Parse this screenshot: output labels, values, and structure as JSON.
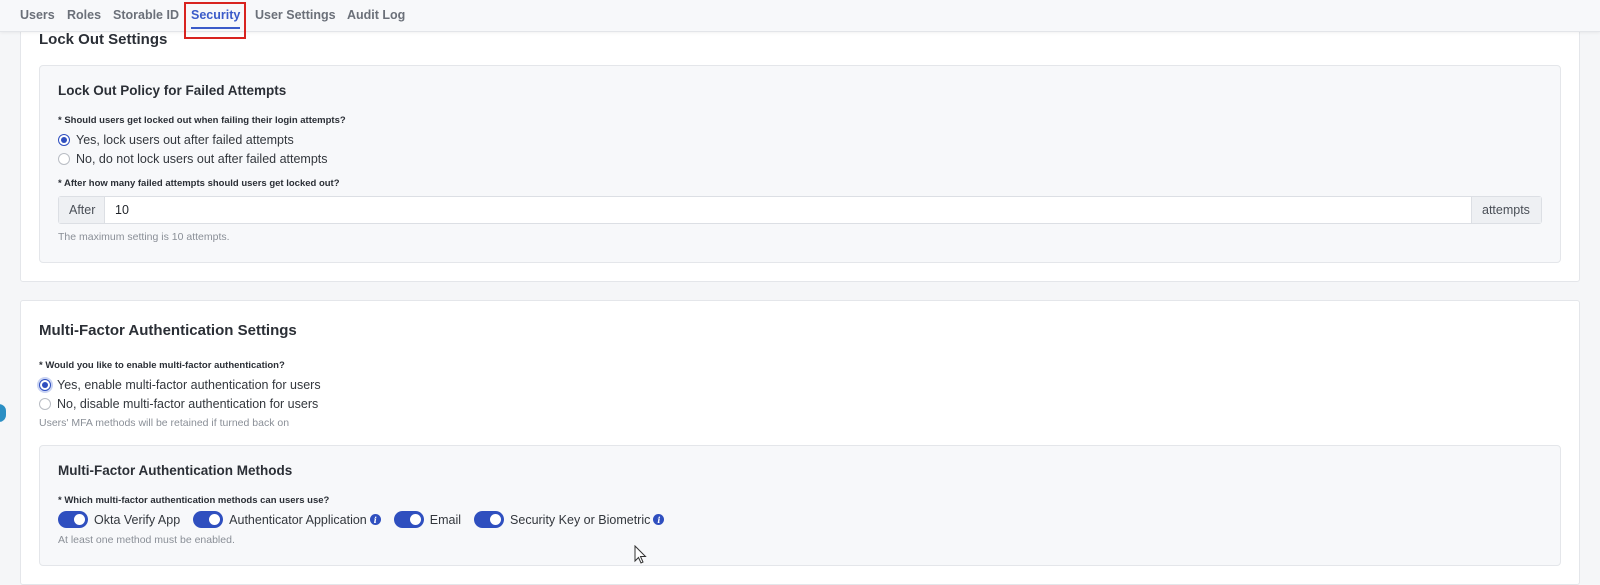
{
  "tabs": [
    {
      "label": "Users"
    },
    {
      "label": "Roles"
    },
    {
      "label": "Storable ID"
    },
    {
      "label": "Security",
      "active": true
    },
    {
      "label": "User Settings"
    },
    {
      "label": "Audit Log"
    }
  ],
  "lockout": {
    "title": "Lock Out Settings",
    "policy_title": "Lock Out Policy for Failed Attempts",
    "question1": "* Should users get locked out when failing their login attempts?",
    "option_yes": "Yes, lock users out after failed attempts",
    "option_no": "No, do not lock users out after failed attempts",
    "selected": "yes",
    "question2": "* After how many failed attempts should users get locked out?",
    "prefix": "After",
    "value": "10",
    "suffix": "attempts",
    "hint": "The maximum setting is 10 attempts."
  },
  "mfa": {
    "title": "Multi-Factor Authentication Settings",
    "question": "* Would you like to enable multi-factor authentication?",
    "option_yes": "Yes, enable multi-factor authentication for users",
    "option_no": "No, disable multi-factor authentication for users",
    "selected": "yes",
    "hint": "Users' MFA methods will be retained if turned back on",
    "methods_title": "Multi-Factor Authentication Methods",
    "methods_question": "* Which multi-factor authentication methods can users use?",
    "methods": [
      {
        "label": "Okta Verify App",
        "enabled": true,
        "info": false
      },
      {
        "label": "Authenticator Application",
        "enabled": true,
        "info": true
      },
      {
        "label": "Email",
        "enabled": true,
        "info": false
      },
      {
        "label": "Security Key or Biometric",
        "enabled": true,
        "info": true
      }
    ],
    "methods_hint": "At least one method must be enabled."
  },
  "colors": {
    "accent": "#2f4fbf",
    "highlight": "#d8231f",
    "tab_active": "#3b5bc9"
  },
  "icons": {
    "info": "info-icon",
    "cursor": "mouse-cursor-icon"
  }
}
